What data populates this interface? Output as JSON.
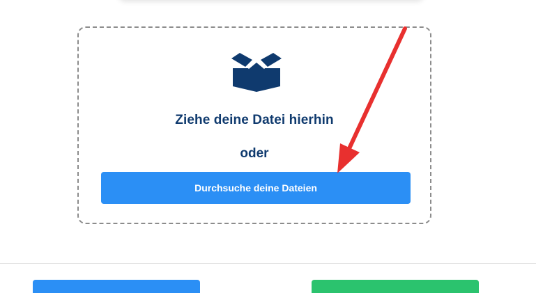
{
  "dropzone": {
    "title": "Ziehe deine Datei hierhin",
    "or_label": "oder",
    "browse_label": "Durchsuche deine Dateien",
    "icon": "open-box-icon"
  },
  "colors": {
    "primary": "#2b8ff5",
    "success": "#2bc36e",
    "text_dark_blue": "#0f3a6e",
    "annotation_red": "#e8302f"
  }
}
